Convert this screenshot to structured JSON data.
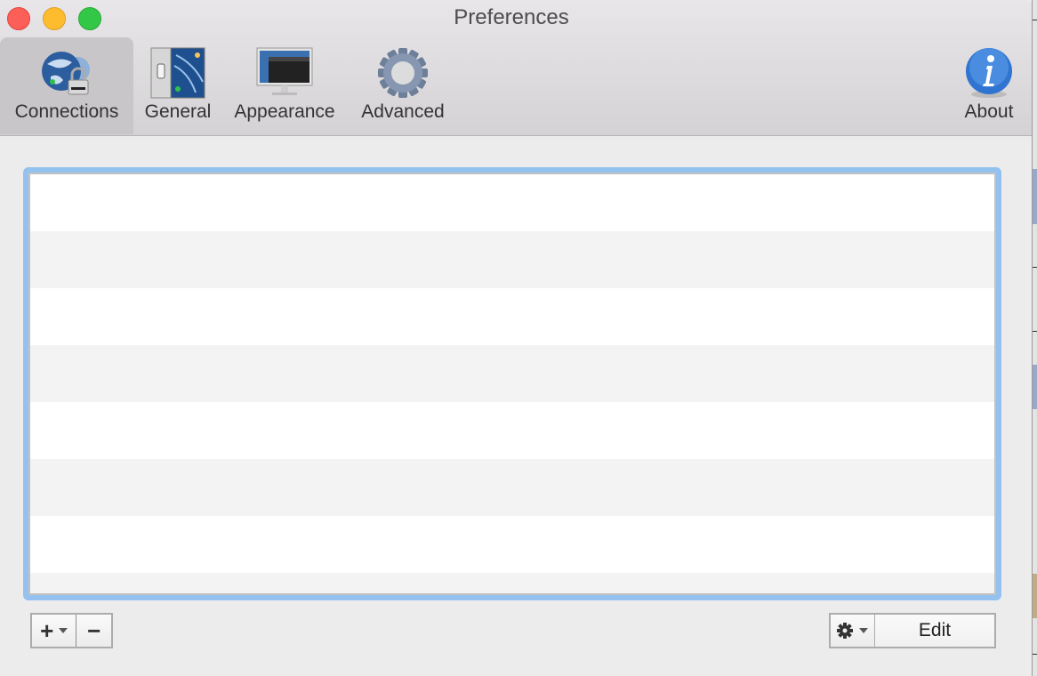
{
  "window": {
    "title": "Preferences",
    "traffic_lights": [
      "close",
      "minimize",
      "zoom"
    ]
  },
  "toolbar": {
    "items": [
      {
        "label": "Connections",
        "icon": "connections-globe-lock-icon",
        "selected": true
      },
      {
        "label": "General",
        "icon": "general-switch-icon",
        "selected": false
      },
      {
        "label": "Appearance",
        "icon": "appearance-monitor-icon",
        "selected": false
      },
      {
        "label": "Advanced",
        "icon": "advanced-gear-icon",
        "selected": false
      },
      {
        "label": "About",
        "icon": "info-icon",
        "selected": false
      }
    ]
  },
  "connections_list": {
    "rows": [
      "",
      "",
      "",
      "",
      "",
      "",
      "",
      ""
    ],
    "focus_color": "#94c2f0"
  },
  "bottom_bar": {
    "add_label": "+",
    "remove_label": "−",
    "action_icon": "gear-icon",
    "edit_label": "Edit"
  }
}
